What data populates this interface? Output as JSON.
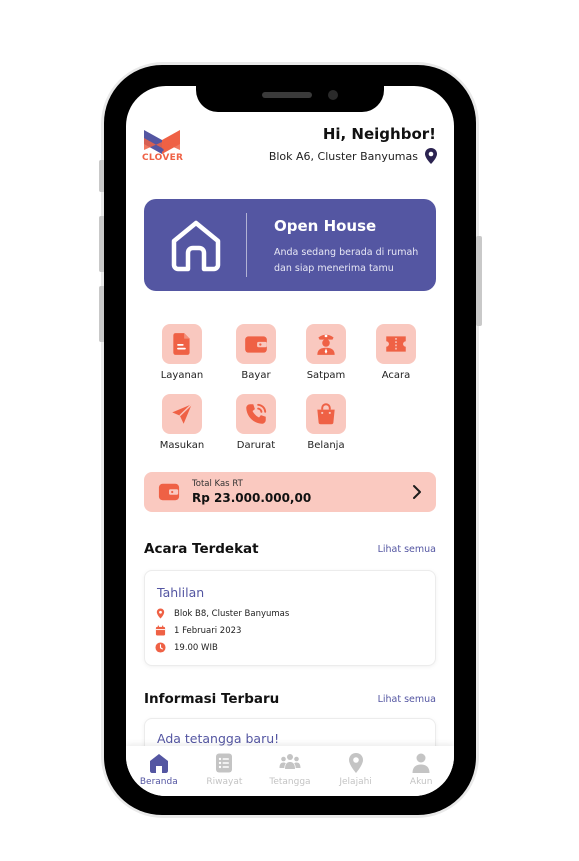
{
  "app": {
    "brand": "CLOVER",
    "greeting": "Hi, Neighbor!",
    "location": "Blok A6, Cluster Banyumas"
  },
  "status_card": {
    "title": "Open House",
    "description": "Anda sedang berada di rumah dan siap menerima tamu"
  },
  "menu": [
    {
      "label": "Layanan",
      "icon": "document-icon"
    },
    {
      "label": "Bayar",
      "icon": "wallet-icon"
    },
    {
      "label": "Satpam",
      "icon": "security-guard-icon"
    },
    {
      "label": "Acara",
      "icon": "ticket-icon"
    },
    {
      "label": "Masukan",
      "icon": "send-icon"
    },
    {
      "label": "Darurat",
      "icon": "phone-call-icon"
    },
    {
      "label": "Belanja",
      "icon": "shopping-bag-icon"
    }
  ],
  "kas": {
    "label": "Total Kas RT",
    "value": "Rp 23.000.000,00"
  },
  "events_section": {
    "title": "Acara Terdekat",
    "see_all": "Lihat semua",
    "event": {
      "title": "Tahlilan",
      "location": "Blok B8, Cluster Banyumas",
      "date": "1 Februari 2023",
      "time": "19.00 WIB"
    }
  },
  "info_section": {
    "title": "Informasi Terbaru",
    "see_all": "Lihat semua",
    "item_title": "Ada tetangga baru!"
  },
  "bottom_nav": [
    {
      "label": "Beranda",
      "icon": "home-icon",
      "active": true
    },
    {
      "label": "Riwayat",
      "icon": "history-icon",
      "active": false
    },
    {
      "label": "Tetangga",
      "icon": "neighbors-icon",
      "active": false
    },
    {
      "label": "Jelajahi",
      "icon": "map-pin-icon",
      "active": false
    },
    {
      "label": "Akun",
      "icon": "user-icon",
      "active": false
    }
  ],
  "colors": {
    "primary": "#5456a2",
    "accent": "#ef6145",
    "accent_light": "#f9c8bf",
    "inactive": "#c4c4c4"
  }
}
